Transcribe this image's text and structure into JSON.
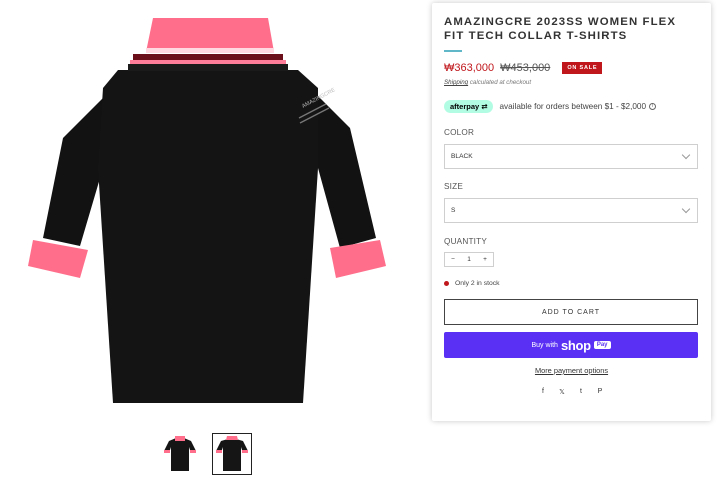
{
  "product": {
    "title": "AMAZINGCRE 2023SS WOMEN FLEX FIT TECH COLLAR T-SHIRTS",
    "price_sale": "₩363,000",
    "price_compare": "₩453,000",
    "badge": "ON SALE",
    "shipping_link": "Shipping",
    "shipping_text": "calculated at checkout",
    "collar_text": "AMAZINGCRE"
  },
  "afterpay": {
    "logo": "afterpay",
    "text": "available for orders between $1 - $2,000",
    "info_icon": "ⓘ"
  },
  "options": {
    "color_label": "COLOR",
    "color_value": "BLACK",
    "size_label": "SIZE",
    "size_value": "S",
    "quantity_label": "QUANTITY",
    "qty_minus": "−",
    "qty_value": "1",
    "qty_plus": "+"
  },
  "stock": {
    "text": "Only 2 in stock",
    "color": "#c0171c"
  },
  "buttons": {
    "add_to_cart": "ADD TO CART",
    "buy_with": "Buy with",
    "shop_word": "shop",
    "pay_word": "Pay",
    "more_options": "More payment options"
  },
  "share": {
    "icons": [
      "facebook-icon",
      "x-icon",
      "twitter-icon",
      "pinterest-icon"
    ],
    "glyphs": [
      "f",
      "𝕏",
      "t",
      "P"
    ]
  },
  "gallery": {
    "thumbnails": [
      "front-view",
      "back-view"
    ],
    "active_thumbnail": 1
  },
  "colors": {
    "accent": "#5a31f4",
    "sale_red": "#c0171c",
    "collar_pink": "#ff6f8c",
    "shirt_black": "#111111"
  }
}
